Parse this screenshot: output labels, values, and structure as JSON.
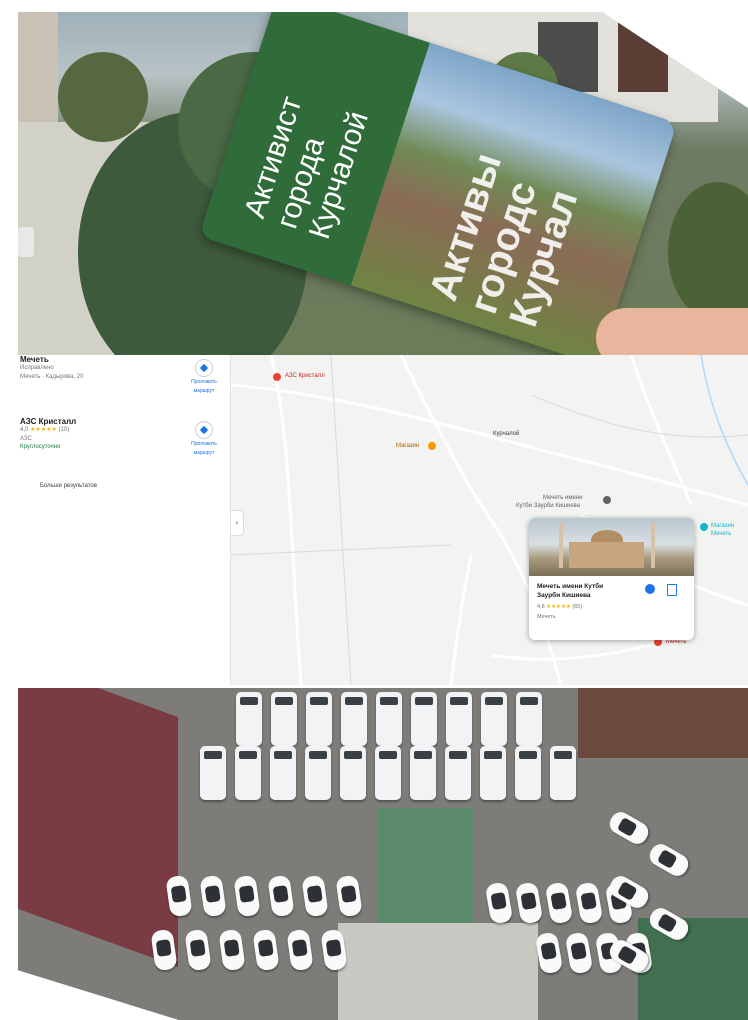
{
  "card": {
    "left_text_lines": [
      "Активист",
      "города",
      "Курчалой"
    ],
    "photo_text_lines": [
      "Активы",
      "городс",
      "Курчал"
    ]
  },
  "sidebar": {
    "places": [
      {
        "name": "Мечеть",
        "line1": "Исправлено",
        "line2": "Мечеть · Кадырова, 20",
        "route_label_1": "Проложить",
        "route_label_2": "маршрут"
      },
      {
        "name": "АЗС Кристалл",
        "rating": "4,0",
        "stars": "★★★★★",
        "count": "(10)",
        "type": "АЗС",
        "status": "Круглосуточно",
        "route_label_1": "Проложить",
        "route_label_2": "маршрут"
      }
    ],
    "more_results": "Больше результатов"
  },
  "map": {
    "labels": {
      "azs": "АЗС Кристалл",
      "poi": "Магазин",
      "city": "Курчалой",
      "mosque_pin_1": "Мечеть имени",
      "mosque_pin_2": "Кутби Заурби Кишиева",
      "right_pin_1": "Магазин",
      "right_pin_2": "Мечеть",
      "bottom_pin": "Мечеть"
    },
    "place_card": {
      "title_1": "Мечеть имени Кутби",
      "title_2": "Заурби Кишиева",
      "rating": "4,8",
      "stars": "★★★★★",
      "count": "(65)",
      "type": "Мечеть"
    },
    "colors": {
      "road": "#ffffff",
      "pin_red": "#ea4335",
      "pin_orange": "#f29900",
      "pin_teal": "#12b5cb",
      "link_blue": "#1a73e8"
    }
  }
}
